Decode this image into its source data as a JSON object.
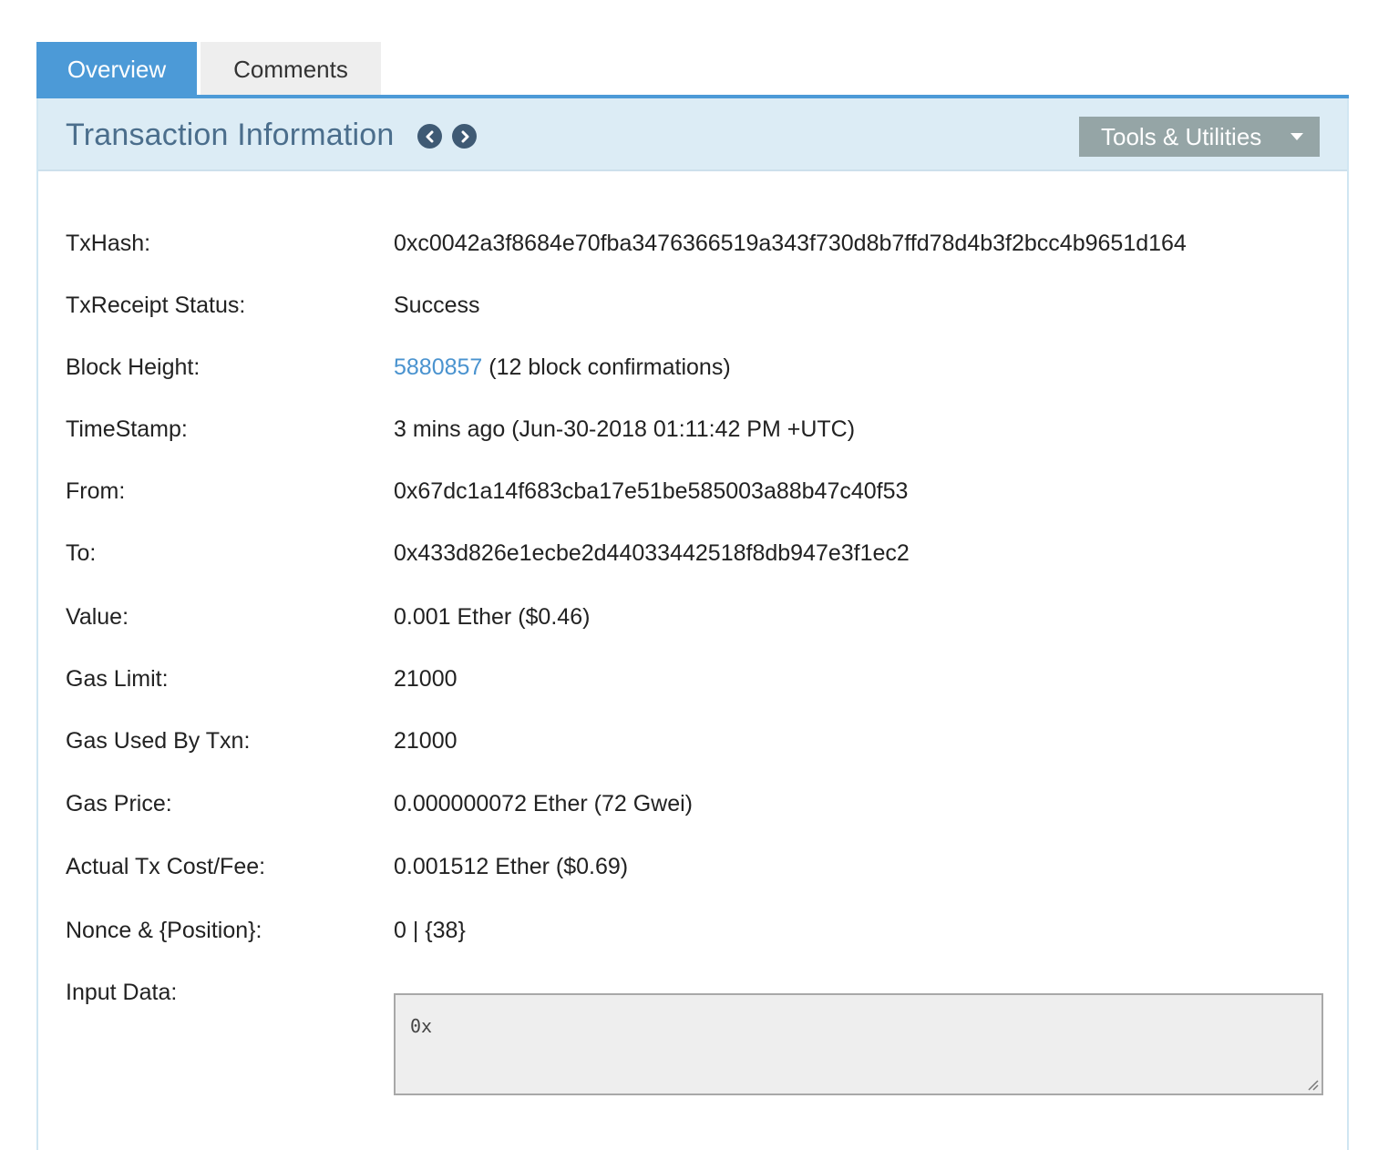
{
  "tabs": [
    {
      "label": "Overview",
      "active": true
    },
    {
      "label": "Comments",
      "active": false
    }
  ],
  "header": {
    "title": "Transaction Information",
    "tools_label": "Tools & Utilities",
    "prev_icon": "chevron-left-circle-icon",
    "next_icon": "chevron-right-circle-icon"
  },
  "details": {
    "txhash": {
      "label": "TxHash:",
      "value": "0xc0042a3f8684e70fba3476366519a343f730d8b7ffd78d4b3f2bcc4b9651d164"
    },
    "status": {
      "label": "TxReceipt Status:",
      "value": "Success"
    },
    "block": {
      "label": "Block Height:",
      "number": "5880857",
      "confirmations": "(12 block confirmations)"
    },
    "timestamp": {
      "label": "TimeStamp:",
      "value": "3 mins ago (Jun-30-2018 01:11:42 PM +UTC)"
    },
    "from": {
      "label": "From:",
      "value": "0x67dc1a14f683cba17e51be585003a88b47c40f53"
    },
    "to": {
      "label": "To:",
      "value": "0x433d826e1ecbe2d44033442518f8db947e3f1ec2"
    },
    "value": {
      "label": "Value:",
      "value": "0.001 Ether ($0.46)"
    },
    "gas_limit": {
      "label": "Gas Limit:",
      "value": "21000"
    },
    "gas_used": {
      "label": "Gas Used By Txn:",
      "value": "21000"
    },
    "gas_price": {
      "label": "Gas Price:",
      "value": "0.000000072 Ether (72 Gwei)"
    },
    "fee": {
      "label": "Actual Tx Cost/Fee:",
      "value": "0.001512 Ether ($0.69)"
    },
    "nonce": {
      "label": "Nonce & {Position}:",
      "value": "0 | {38}"
    },
    "input": {
      "label": "Input Data:",
      "value": "0x"
    }
  },
  "colors": {
    "accent": "#4c9ad7",
    "link": "#4a93cf",
    "success": "#2f7d1f",
    "header_bg": "#dcecf5",
    "tools_bg": "#95a5a6"
  }
}
